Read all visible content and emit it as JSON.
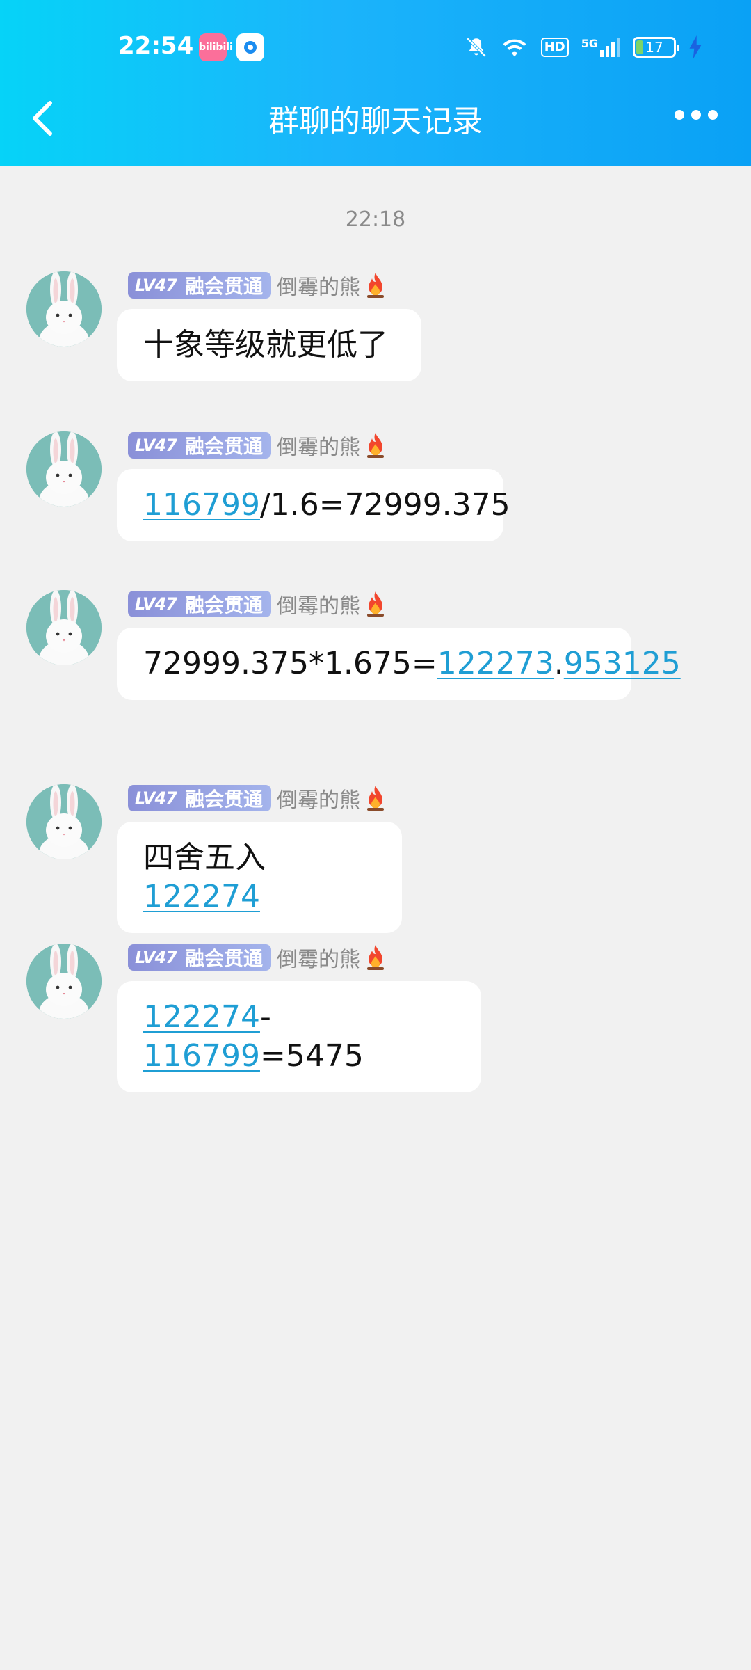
{
  "status_bar": {
    "time": "22:54",
    "app_icon_1": "bilibili",
    "app_icon_1_text": "bilibili",
    "app_icon_2": "circle-app-icon",
    "hd": "HD",
    "network": "5G",
    "battery": "17"
  },
  "header": {
    "title": "群聊的聊天记录",
    "back_icon": "chevron-left-icon",
    "more_icon": "more-dots-icon"
  },
  "timestamp": "22:18",
  "sender": {
    "level": "LV47",
    "title": "融会贯通",
    "name": "倒霉的熊"
  },
  "messages": [
    {
      "segments": [
        {
          "text": "十象等级就更低了",
          "link": false
        }
      ]
    },
    {
      "segments": [
        {
          "text": "116799",
          "link": true
        },
        {
          "text": "/1.6=72999.375",
          "link": false
        }
      ]
    },
    {
      "segments": [
        {
          "text": "72999.375*1.675=",
          "link": false
        },
        {
          "text": "122273",
          "link": true
        },
        {
          "text": ".",
          "link": false
        },
        {
          "text": "953125",
          "link": true
        }
      ]
    },
    {
      "segments": [
        {
          "text": "四舍五入",
          "link": false
        },
        {
          "text": "122274",
          "link": true
        }
      ]
    },
    {
      "segments": [
        {
          "text": "122274",
          "link": true
        },
        {
          "text": "-",
          "link": false
        },
        {
          "text": "116799",
          "link": true
        },
        {
          "text": "=5475",
          "link": false
        }
      ]
    }
  ],
  "colors": {
    "header_start": "#06d3f8",
    "header_end": "#0aa1f5",
    "link": "#1f9ed4",
    "background": "#f1f1f1"
  }
}
